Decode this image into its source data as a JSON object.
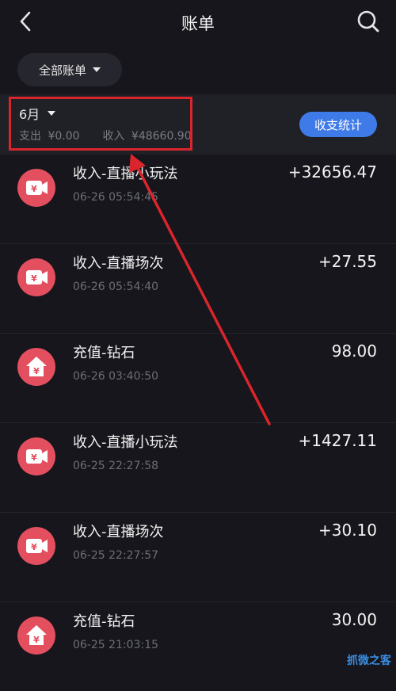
{
  "header": {
    "title": "账单",
    "back_icon": "chevron-left-icon",
    "search_icon": "search-icon"
  },
  "filter": {
    "label": "全部账单"
  },
  "month": {
    "label": "6月",
    "expense_label": "支出",
    "expense_value": "¥0.00",
    "income_label": "收入",
    "income_value": "¥48660.90",
    "stats_button": "收支统计"
  },
  "transactions": [
    {
      "icon": "income-video-icon",
      "title": "收入-直播小玩法",
      "time": "06-26 05:54:45",
      "amount": "+32656.47"
    },
    {
      "icon": "income-video-icon",
      "title": "收入-直播场次",
      "time": "06-26 05:54:40",
      "amount": "+27.55"
    },
    {
      "icon": "recharge-home-icon",
      "title": "充值-钻石",
      "time": "06-26 03:40:50",
      "amount": "98.00"
    },
    {
      "icon": "income-video-icon",
      "title": "收入-直播小玩法",
      "time": "06-25 22:27:58",
      "amount": "+1427.11"
    },
    {
      "icon": "income-video-icon",
      "title": "收入-直播场次",
      "time": "06-25 22:27:57",
      "amount": "+30.10"
    },
    {
      "icon": "recharge-home-icon",
      "title": "充值-钻石",
      "time": "06-25 21:03:15",
      "amount": "30.00"
    }
  ],
  "colors": {
    "background": "#16161c",
    "accent": "#3f7be8",
    "icon_bg": "#e34f5e",
    "highlight": "#d9252b"
  },
  "watermark": "抓微之客"
}
